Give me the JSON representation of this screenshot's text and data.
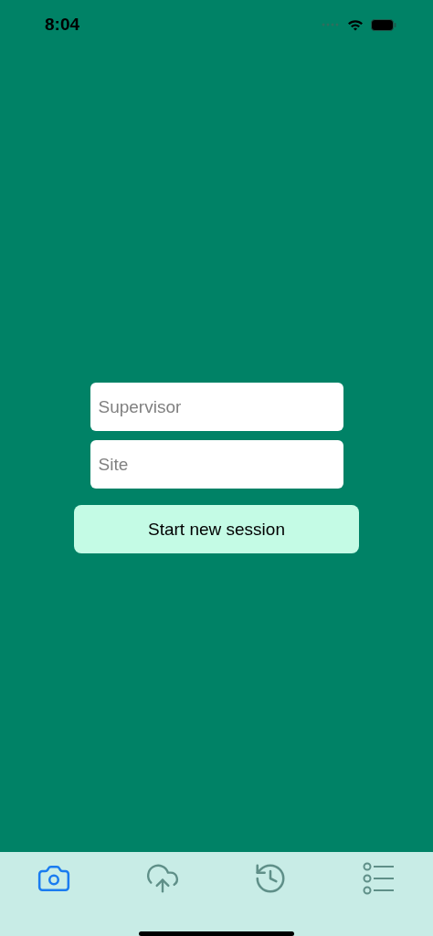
{
  "status_bar": {
    "time": "8:04"
  },
  "form": {
    "fields": [
      {
        "placeholder": "Supervisor"
      },
      {
        "placeholder": "Site"
      }
    ],
    "button": "Start new session"
  },
  "tab_bar": [
    {
      "kind": "camera",
      "selected": true
    },
    {
      "kind": "upload",
      "selected": false
    },
    {
      "kind": "history",
      "selected": false
    },
    {
      "kind": "list",
      "selected": false
    }
  ]
}
